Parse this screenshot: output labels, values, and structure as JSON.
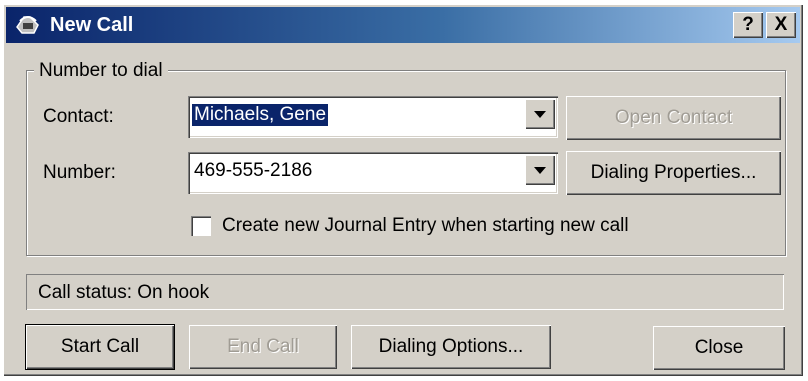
{
  "window": {
    "title": "New Call",
    "help_glyph": "?",
    "close_glyph": "X"
  },
  "group": {
    "legend": "Number to dial",
    "contact_label": "Contact:",
    "contact_value": "Michaels, Gene",
    "number_label": "Number:",
    "number_value": "469-555-2186",
    "open_contact_label": "Open Contact",
    "dialing_properties_label": "Dialing Properties...",
    "journal_checkbox_label": "Create new Journal Entry when starting new call",
    "journal_checked": false
  },
  "status": {
    "text": "Call status: On hook"
  },
  "buttons": {
    "start_call": "Start Call",
    "end_call": "End Call",
    "dialing_options": "Dialing Options...",
    "close": "Close"
  },
  "icons": {
    "title_icon": "phone-icon",
    "help": "question-icon",
    "close": "close-icon",
    "dropdown": "chevron-down-icon"
  },
  "colors": {
    "titlebar_start": "#0a246a",
    "titlebar_end": "#a6caf0",
    "face": "#d4d0c8",
    "selection": "#0a246a"
  }
}
